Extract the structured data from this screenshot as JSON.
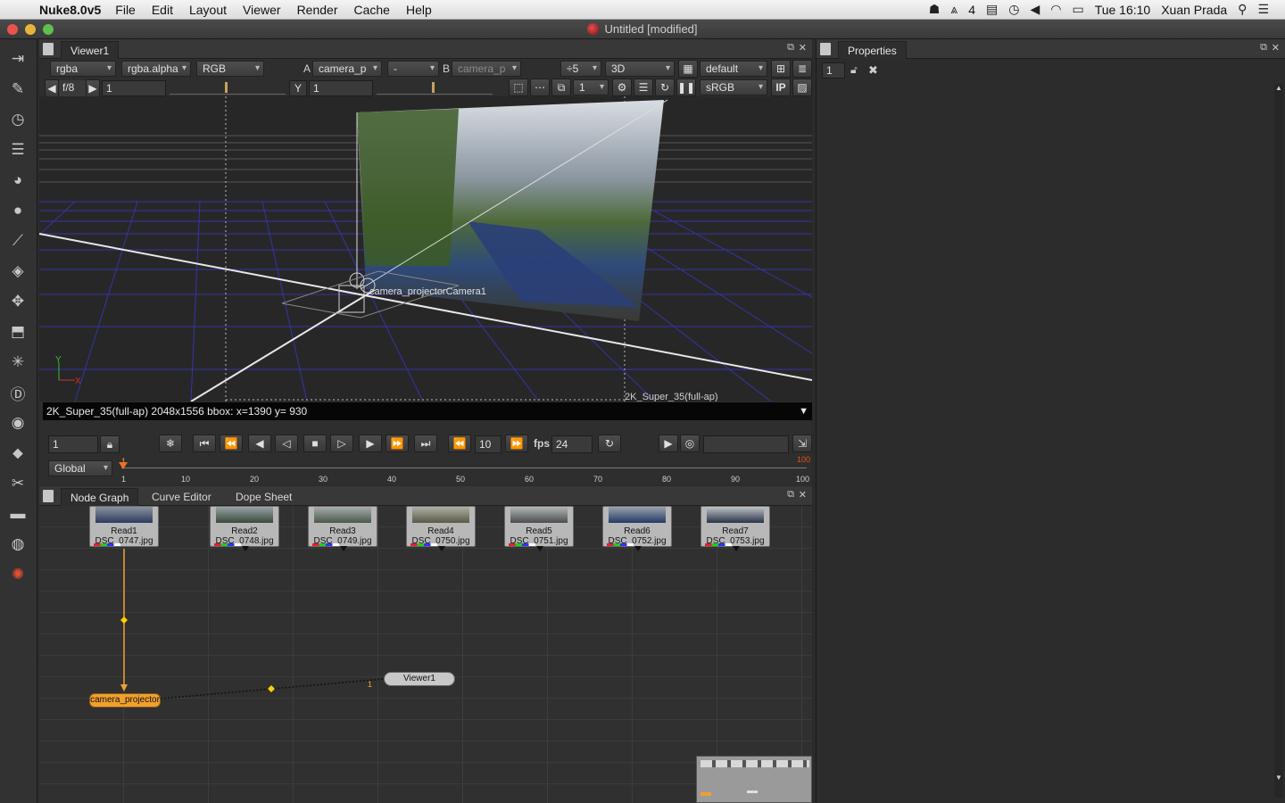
{
  "menubar": {
    "app": "Nuke8.0v5",
    "items": [
      "File",
      "Edit",
      "Layout",
      "Viewer",
      "Render",
      "Cache",
      "Help"
    ],
    "status_badge": "4",
    "clock": "Tue 16:10",
    "user": "Xuan Prada"
  },
  "window": {
    "title": "Untitled [modified]"
  },
  "viewer": {
    "tab": "Viewer1",
    "row1": {
      "channels": "rgba",
      "alpha": "rgba.alpha",
      "display": "RGB",
      "a_label": "A",
      "a_input": "camera_p",
      "op": "-",
      "b_label": "B",
      "b_input": "camera_p",
      "downrez": "÷5",
      "mode": "3D",
      "camera": "default"
    },
    "row2": {
      "fstop": "f/8",
      "gain": "1",
      "y_label": "Y",
      "gamma": "1",
      "proxy": "1",
      "lut": "sRGB",
      "ip": "IP"
    },
    "scene": {
      "camera_label": "camera_projectorCamera1",
      "format_label": "2K_Super_35(full-ap)",
      "axis_x": "X",
      "axis_y": "Y"
    },
    "info": "2K_Super_35(full-ap) 2048x1556 bbox: ",
    "coords": " x=1390 y= 930"
  },
  "playback": {
    "frame": "1",
    "step": "10",
    "fps_label": "fps",
    "fps": "24",
    "range_mode": "Global",
    "start": "1",
    "end": "100",
    "ticks": [
      "1",
      "10",
      "20",
      "30",
      "40",
      "50",
      "60",
      "70",
      "80",
      "90",
      "100"
    ]
  },
  "nodegraph": {
    "tabs": [
      "Node Graph",
      "Curve Editor",
      "Dope Sheet"
    ],
    "reads": [
      {
        "name": "Read1",
        "file": "DSC_0747.jpg"
      },
      {
        "name": "Read2",
        "file": "DSC_0748.jpg"
      },
      {
        "name": "Read3",
        "file": "DSC_0749.jpg"
      },
      {
        "name": "Read4",
        "file": "DSC_0750.jpg"
      },
      {
        "name": "Read5",
        "file": "DSC_0751.jpg"
      },
      {
        "name": "Read6",
        "file": "DSC_0752.jpg"
      },
      {
        "name": "Read7",
        "file": "DSC_0753.jpg"
      }
    ],
    "projector": "camera_projector",
    "viewer_node": "Viewer1",
    "input_number": "1"
  },
  "properties": {
    "tab": "Properties",
    "max_panels": "1"
  },
  "colors": {
    "accent_orange": "#f0a030",
    "grid_blue": "#3a3ab0",
    "timeline_marker": "#e85010"
  }
}
